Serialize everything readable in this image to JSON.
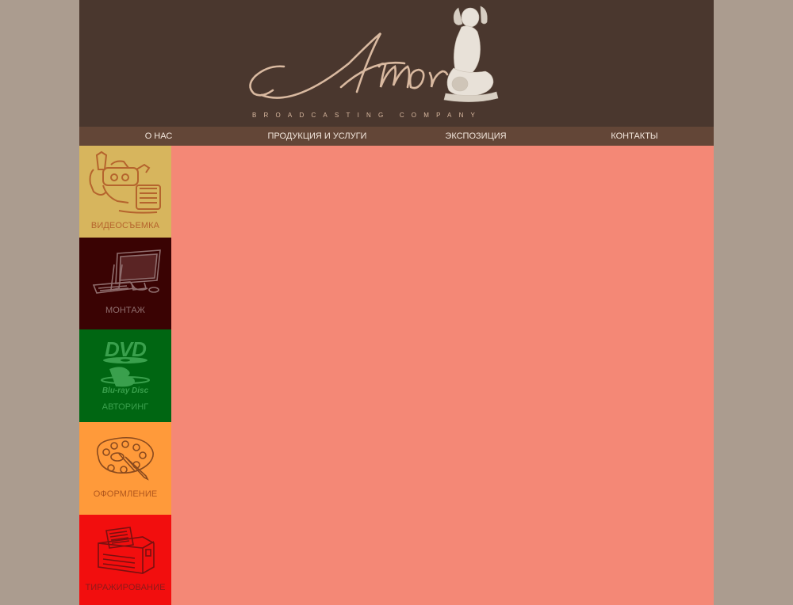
{
  "header": {
    "logo_script": "Amor",
    "logo_tagline": "BROADCASTING COMPANY"
  },
  "nav": {
    "items": [
      {
        "label": "О НАС"
      },
      {
        "label": "ПРОДУКЦИЯ И УСЛУГИ"
      },
      {
        "label": "ЭКСПОЗИЦИЯ"
      },
      {
        "label": "КОНТАКТЫ"
      }
    ]
  },
  "services": {
    "items": [
      {
        "label": "ВИДЕОСЪЕМКА",
        "icon": "video-camera-icon"
      },
      {
        "label": "МОНТАЖ",
        "icon": "editing-workstation-icon"
      },
      {
        "label": "АВТОРИНГ",
        "icon": "dvd-bluray-logo-icon"
      },
      {
        "label": "ОФОРМЛЕНИЕ",
        "icon": "palette-icon"
      },
      {
        "label": "ТИРАЖИРОВАНИЕ",
        "icon": "disc-duplicator-icon"
      }
    ]
  },
  "colors": {
    "page_background": "#ab9c8f",
    "header_background": "#4a372e",
    "nav_background": "#634637",
    "content_background": "#f48876"
  }
}
